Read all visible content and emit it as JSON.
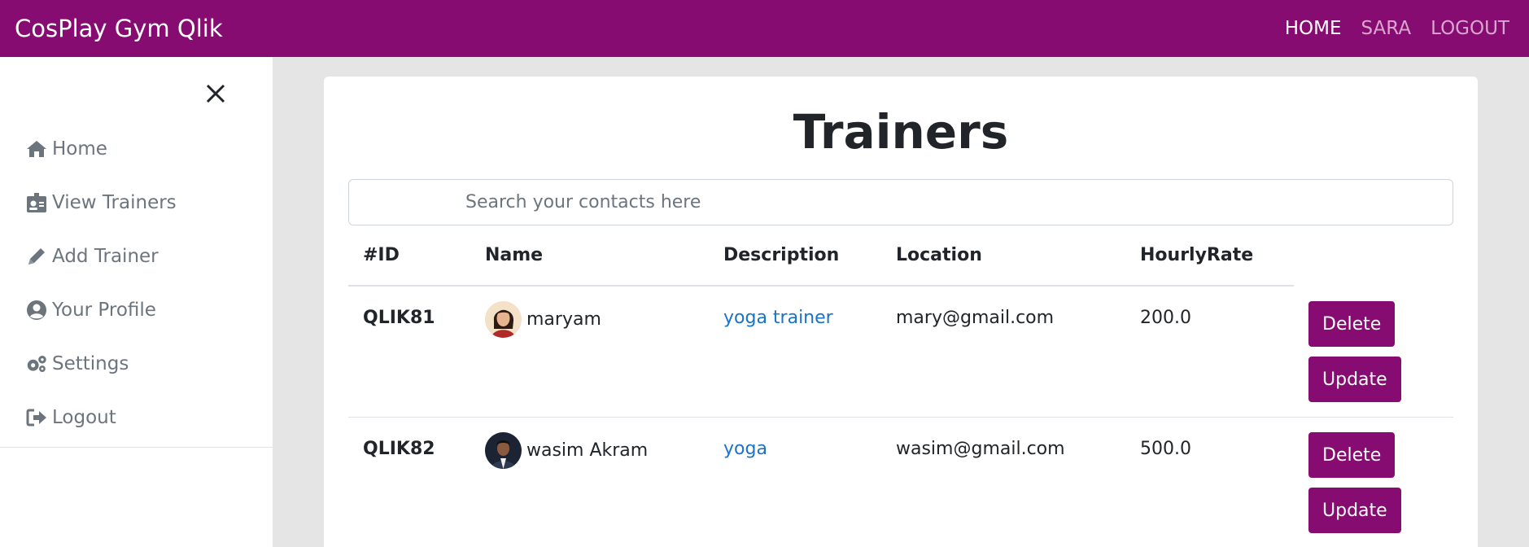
{
  "navbar": {
    "brand": "CosPlay Gym Qlik",
    "links": [
      {
        "label": "HOME"
      },
      {
        "label": "SARA"
      },
      {
        "label": "LOGOUT"
      }
    ]
  },
  "sidebar": {
    "items": [
      {
        "label": "Home",
        "icon": "home-icon"
      },
      {
        "label": "View Trainers",
        "icon": "id-badge-icon"
      },
      {
        "label": "Add Trainer",
        "icon": "pencil-icon"
      },
      {
        "label": "Your Profile",
        "icon": "user-circle-icon"
      },
      {
        "label": "Settings",
        "icon": "gears-icon"
      },
      {
        "label": "Logout",
        "icon": "sign-out-icon"
      }
    ]
  },
  "main": {
    "title": "Trainers",
    "search_placeholder": "Search your contacts here",
    "columns": [
      "#ID",
      "Name",
      "Description",
      "Location",
      "HourlyRate"
    ],
    "rows": [
      {
        "id": "QLIK81",
        "name": "maryam",
        "description": "yoga trainer",
        "location": "mary@gmail.com",
        "rate": "200.0"
      },
      {
        "id": "QLIK82",
        "name": "wasim Akram",
        "description": "yoga",
        "location": "wasim@gmail.com",
        "rate": "500.0"
      }
    ],
    "delete_label": "Delete",
    "update_label": "Update"
  },
  "colors": {
    "brand": "#870c72",
    "link": "#1a73c8"
  }
}
